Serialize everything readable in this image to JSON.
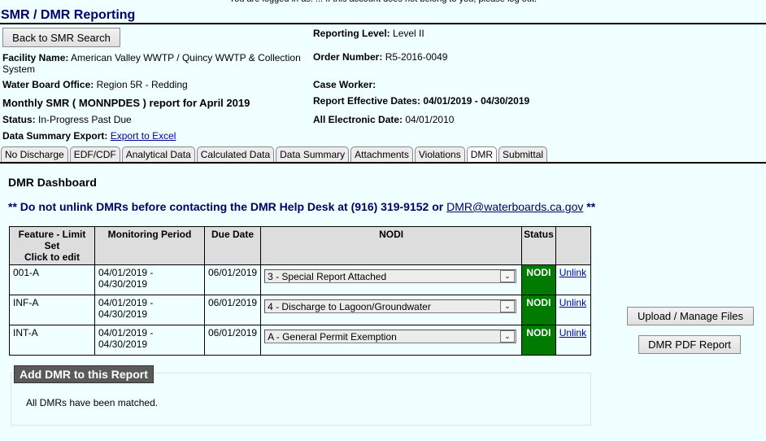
{
  "top_notice": "You are logged in as: ... If this account does not belong to you, please log out.",
  "header": {
    "title": "SMR / DMR Reporting",
    "back_button": "Back to SMR Search"
  },
  "info": {
    "facility_label": "Facility Name:",
    "facility_value": "American Valley WWTP / Quincy WWTP & Collection System",
    "office_label": "Water Board Office:",
    "office_value": "Region 5R - Redding",
    "report_title": "Monthly SMR ( MONNPDES ) report for April 2019",
    "status_label": "Status:",
    "status_value": "In-Progress Past Due",
    "export_label": "Data Summary Export:",
    "export_link": "Export to Excel",
    "reporting_level_label": "Reporting Level:",
    "reporting_level_value": "Level II",
    "order_label": "Order Number:",
    "order_value": "R5-2016-0049",
    "case_worker_label": "Case Worker:",
    "case_worker_value": "",
    "effective_label": "Report Effective Dates:",
    "effective_value": "04/01/2019 - 04/30/2019",
    "electronic_label": "All Electronic Date:",
    "electronic_value": "04/01/2010"
  },
  "tabs": [
    {
      "label": "No Discharge",
      "active": false
    },
    {
      "label": "EDF/CDF",
      "active": false
    },
    {
      "label": "Analytical Data",
      "active": false
    },
    {
      "label": "Calculated Data",
      "active": false
    },
    {
      "label": "Data Summary",
      "active": false
    },
    {
      "label": "Attachments",
      "active": false
    },
    {
      "label": "Violations",
      "active": false
    },
    {
      "label": "DMR",
      "active": true
    },
    {
      "label": "Submittal",
      "active": false
    }
  ],
  "dashboard": {
    "title": "DMR Dashboard",
    "warning_prefix": "** Do not unlink DMRs before contacting the DMR Help Desk at (916) 319-9152 or ",
    "warning_email": "DMR@waterboards.ca.gov",
    "warning_suffix": " **"
  },
  "table": {
    "headers": {
      "feature_line1": "Feature - Limit Set",
      "feature_line2": "Click to edit",
      "period": "Monitoring Period",
      "due": "Due Date",
      "nodi": "NODI",
      "status": "Status",
      "action": ""
    },
    "rows": [
      {
        "feature": "001-A",
        "period": "04/01/2019 - 04/30/2019",
        "due": "06/01/2019",
        "nodi": "3 - Special Report Attached",
        "status": "NODI",
        "action": "Unlink"
      },
      {
        "feature": "INF-A",
        "period": "04/01/2019 - 04/30/2019",
        "due": "06/01/2019",
        "nodi": "4 - Discharge to Lagoon/Groundwater",
        "status": "NODI",
        "action": "Unlink"
      },
      {
        "feature": "INT-A",
        "period": "04/01/2019 - 04/30/2019",
        "due": "06/01/2019",
        "nodi": "A - General Permit Exemption",
        "status": "NODI",
        "action": "Unlink"
      }
    ]
  },
  "side_buttons": {
    "upload": "Upload / Manage Files",
    "pdf": "DMR PDF Report"
  },
  "add_dmr": {
    "legend": "Add DMR to this Report",
    "message": "All DMRs have been matched."
  },
  "colors": {
    "background": "#f0ffff",
    "title": "#000066",
    "status_ok": "#007a00",
    "legend_bg": "#5a5a5a"
  }
}
